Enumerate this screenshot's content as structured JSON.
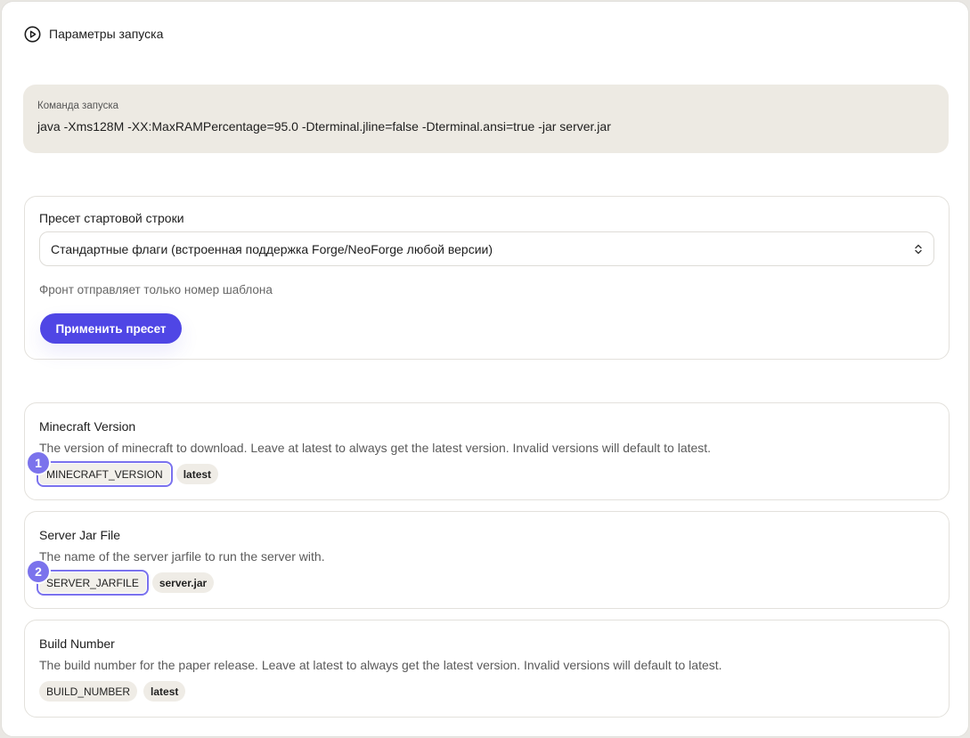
{
  "section": {
    "title": "Параметры запуска",
    "icon": "play-circle-icon"
  },
  "command": {
    "label": "Команда запуска",
    "value": "java -Xms128M -XX:MaxRAMPercentage=95.0 -Dterminal.jline=false -Dterminal.ansi=true -jar server.jar"
  },
  "preset": {
    "label": "Пресет стартовой строки",
    "selected": "Стандартные флаги (встроенная поддержка Forge/NeoForge любой версии)",
    "hint": "Фронт отправляет только номер шаблона",
    "apply_label": "Применить пресет"
  },
  "variables": [
    {
      "title": "Minecraft Version",
      "description": "The version of minecraft to download. Leave at latest to always get the latest version. Invalid versions will default to latest.",
      "env": "MINECRAFT_VERSION",
      "value": "latest",
      "marker": "1"
    },
    {
      "title": "Server Jar File",
      "description": "The name of the server jarfile to run the server with.",
      "env": "SERVER_JARFILE",
      "value": "server.jar",
      "marker": "2"
    },
    {
      "title": "Build Number",
      "description": "The build number for the paper release. Leave at latest to always get the latest version. Invalid versions will default to latest.",
      "env": "BUILD_NUMBER",
      "value": "latest"
    }
  ],
  "colors": {
    "accent": "#4f46e5",
    "marker": "#7b73ec",
    "command_bg": "#edeae3",
    "chip_bg": "#efece6"
  }
}
